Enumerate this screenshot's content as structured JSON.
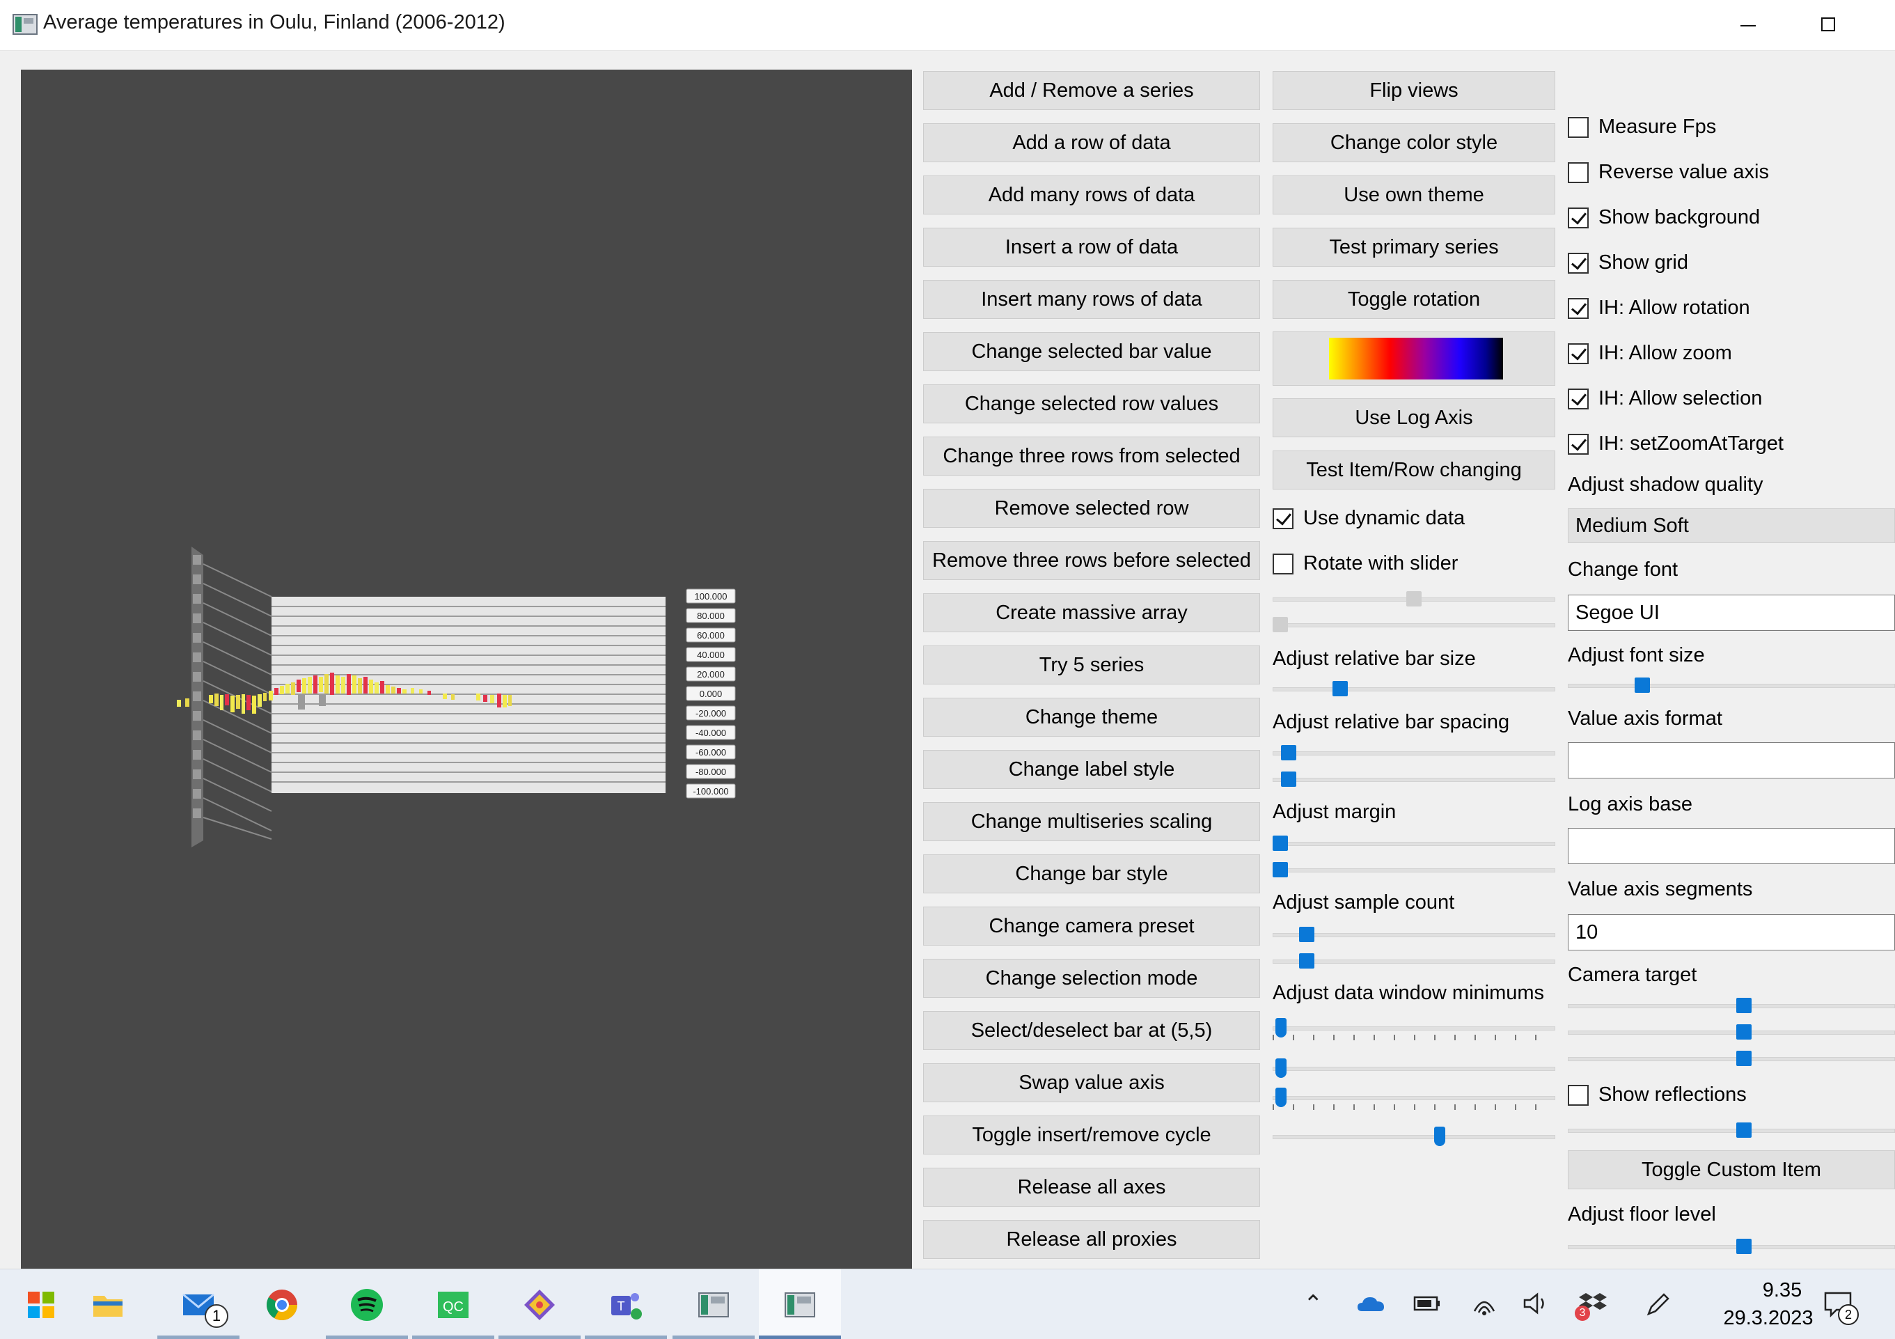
{
  "window": {
    "title": "Average temperatures in Oulu, Finland (2006-2012)"
  },
  "graph": {
    "value_axis_labels": [
      "100.000",
      "80.000",
      "60.000",
      "40.000",
      "20.000",
      "0.000",
      "-20.000",
      "-40.000",
      "-60.000",
      "-80.000",
      "-100.000"
    ]
  },
  "buttons_col1": [
    "Add / Remove a series",
    "Add a row of data",
    "Add many rows of data",
    "Insert a row of data",
    "Insert many rows of data",
    "Change selected bar value",
    "Change selected row values",
    "Change three rows from selected",
    "Remove selected row",
    "Remove three rows before selected",
    "Create massive array",
    "Try 5 series",
    "Change theme",
    "Change label style",
    "Change multiseries scaling",
    "Change bar style",
    "Change camera preset",
    "Change selection mode",
    "Select/deselect bar at (5,5)",
    "Swap value axis",
    "Toggle insert/remove cycle",
    "Release all axes",
    "Release all proxies"
  ],
  "buttons_col2": {
    "flip_views": "Flip views",
    "change_color_style": "Change color style",
    "use_own_theme": "Use own theme",
    "test_primary_series": "Test primary series",
    "toggle_rotation": "Toggle rotation",
    "use_log_axis": "Use Log Axis",
    "test_item_row_changing": "Test Item/Row changing"
  },
  "col2": {
    "use_dynamic_data": {
      "label": "Use dynamic data",
      "checked": true
    },
    "rotate_with_slider": {
      "label": "Rotate with slider",
      "checked": false
    },
    "adjust_relative_bar_size": "Adjust relative bar size",
    "adjust_relative_bar_spacing": "Adjust relative bar spacing",
    "adjust_margin": "Adjust margin",
    "adjust_sample_count": "Adjust sample count",
    "adjust_data_window_minimums": "Adjust data window minimums"
  },
  "col3": {
    "checkboxes": [
      {
        "label": "Measure Fps",
        "checked": false
      },
      {
        "label": "Reverse value axis",
        "checked": false
      },
      {
        "label": "Show background",
        "checked": true
      },
      {
        "label": "Show grid",
        "checked": true
      },
      {
        "label": "IH: Allow rotation",
        "checked": true
      },
      {
        "label": "IH: Allow zoom",
        "checked": true
      },
      {
        "label": "IH: Allow selection",
        "checked": true
      },
      {
        "label": "IH: setZoomAtTarget",
        "checked": true
      }
    ],
    "adjust_shadow_quality": "Adjust shadow quality",
    "shadow_quality_value": "Medium Soft",
    "change_font": "Change font",
    "font_value": "Segoe UI",
    "adjust_font_size": "Adjust font size",
    "value_axis_format": "Value axis format",
    "value_axis_format_value": "",
    "log_axis_base": "Log axis base",
    "log_axis_base_value": "",
    "value_axis_segments": "Value axis segments",
    "value_axis_segments_value": "10",
    "camera_target": "Camera target",
    "show_reflections": {
      "label": "Show reflections",
      "checked": false
    },
    "toggle_custom_item": "Toggle Custom Item",
    "adjust_floor_level": "Adjust floor level"
  },
  "taskbar": {
    "apps": [
      "start-icon",
      "file-explorer-icon",
      "mail-icon",
      "chrome-icon",
      "spotify-icon",
      "qtcreator-icon",
      "git-icon",
      "teams-icon",
      "graph-app-icon",
      "graph-app-active-icon"
    ],
    "mail_badge": "1",
    "clock_time": "9.35",
    "clock_date": "29.3.2023",
    "notification_count": "2",
    "tray_badge": "3"
  },
  "colors": {
    "accent": "#0a78d7",
    "viewport_bg": "#484848",
    "button_bg": "#e1e1e1"
  }
}
